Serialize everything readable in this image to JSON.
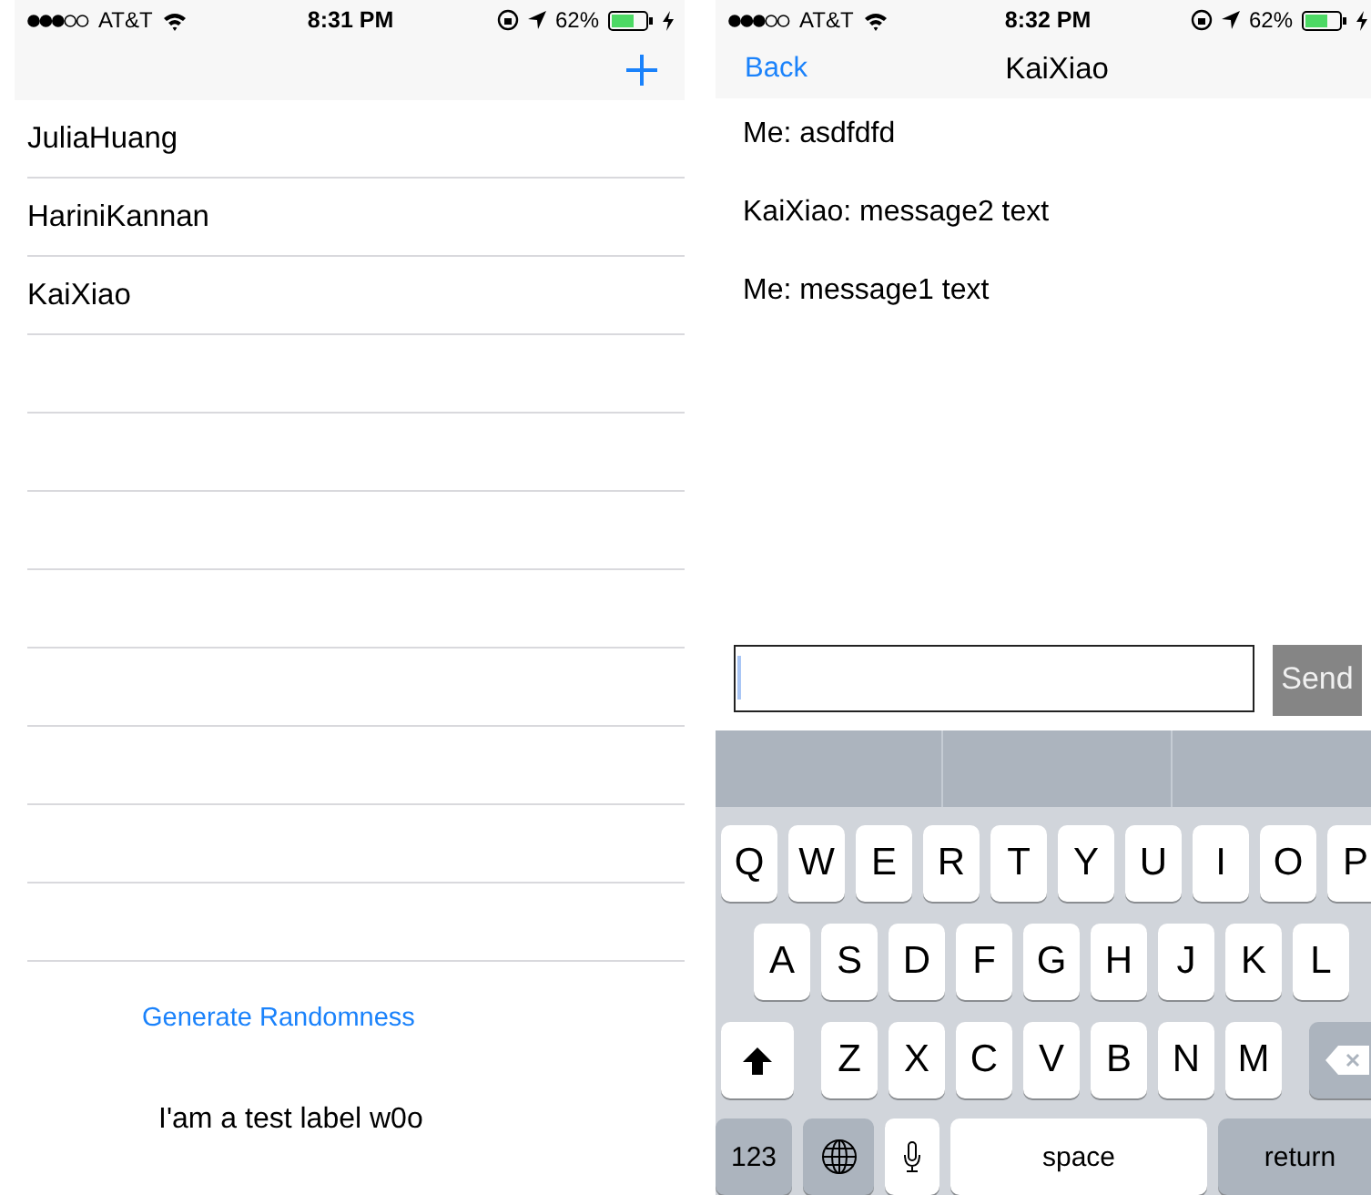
{
  "left_screen": {
    "status_bar": {
      "carrier": "AT&T",
      "time": "8:31 PM",
      "battery": "62%"
    },
    "contacts": [
      {
        "name": "JuliaHuang"
      },
      {
        "name": "HariniKannan"
      },
      {
        "name": "KaiXiao"
      }
    ],
    "generate_button": "Generate Randomness",
    "test_label": "I'am a test label w0o"
  },
  "right_screen": {
    "status_bar": {
      "carrier": "AT&T",
      "time": "8:32 PM",
      "battery": "62%"
    },
    "nav": {
      "back": "Back",
      "title": "KaiXiao"
    },
    "messages": [
      "Me: asdfdfd",
      "KaiXiao: message2 text",
      "Me: message1 text"
    ],
    "composer": {
      "send": "Send"
    },
    "keyboard": {
      "rows": [
        [
          "Q",
          "W",
          "E",
          "R",
          "T",
          "Y",
          "U",
          "I",
          "O",
          "P"
        ],
        [
          "A",
          "S",
          "D",
          "F",
          "G",
          "H",
          "J",
          "K",
          "L"
        ],
        [
          "Z",
          "X",
          "C",
          "V",
          "B",
          "N",
          "M"
        ]
      ],
      "numbers": "123",
      "space": "space",
      "return": "return"
    }
  }
}
